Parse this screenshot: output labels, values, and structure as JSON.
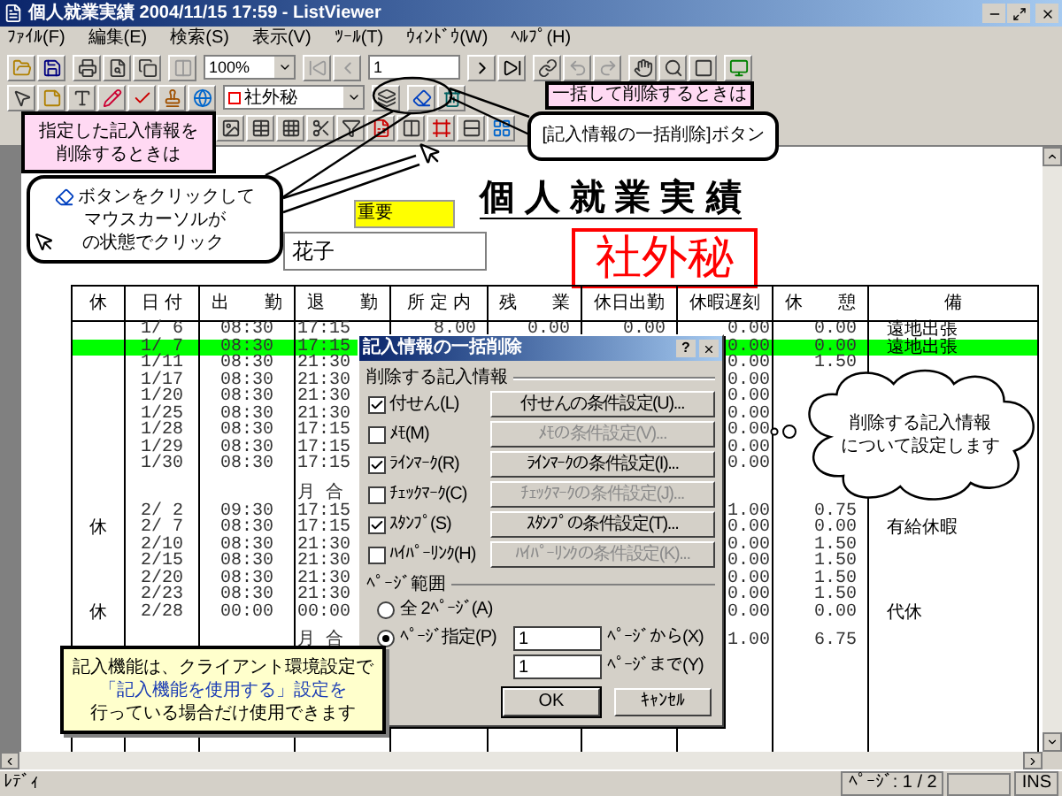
{
  "window": {
    "title": "個人就業実績 2004/11/15 17:59 - ListViewer"
  },
  "menu": [
    "ﾌｧｲﾙ(F)",
    "編集(E)",
    "検索(S)",
    "表示(V)",
    "ﾂｰﾙ(T)",
    "ｳｨﾝﾄﾞｳ(W)",
    "ﾍﾙﾌﾟ(H)"
  ],
  "toolbar": {
    "zoom": "100%",
    "page": "1",
    "stamp_select": "社外秘"
  },
  "document": {
    "badge": "重要",
    "title": "個 人 就 業 実 績",
    "name": "花子",
    "stamp": "社外秘",
    "table": {
      "columns": [
        "休",
        "日 付",
        "出　　勤",
        "退　　勤",
        "所 定 内",
        "残　　業",
        "休日出勤",
        "休暇遅刻",
        "休　　憩",
        "備"
      ],
      "rows": [
        {
          "kind": "day",
          "highlighted": false,
          "date": "1/ 6",
          "in": "08:30",
          "out": "17:15",
          "regular": "8.00",
          "overtime": "0.00",
          "holiday": "0.00",
          "absence": "0.00",
          "break": "0.00",
          "note": "遠地出張"
        },
        {
          "kind": "day",
          "highlighted": true,
          "date": "1/ 7",
          "in": "08:30",
          "out": "17:15",
          "absence": "0.00",
          "break": "0.00",
          "note": "遠地出張"
        },
        {
          "kind": "day",
          "highlighted": false,
          "date": "1/11",
          "in": "08:30",
          "out": "21:30",
          "absence": "0.00",
          "break": "1.50"
        },
        {
          "kind": "day",
          "highlighted": false,
          "date": "1/17",
          "in": "08:30",
          "out": "21:30",
          "absence": "0.00"
        },
        {
          "kind": "day",
          "highlighted": false,
          "date": "1/20",
          "in": "08:30",
          "out": "21:30",
          "absence": "0.00"
        },
        {
          "kind": "day",
          "highlighted": false,
          "date": "1/25",
          "in": "08:30",
          "out": "21:30",
          "absence": "0.00"
        },
        {
          "kind": "day",
          "highlighted": false,
          "date": "1/28",
          "in": "08:30",
          "out": "17:15",
          "absence": "0.00"
        },
        {
          "kind": "day",
          "highlighted": false,
          "date": "1/29",
          "in": "08:30",
          "out": "17:15",
          "absence": "0.00"
        },
        {
          "kind": "day",
          "highlighted": false,
          "date": "1/30",
          "in": "08:30",
          "out": "17:15",
          "absence": "0.00"
        },
        {
          "kind": "total",
          "highlighted": false,
          "label": "月 合"
        },
        {
          "kind": "day",
          "highlighted": false,
          "date": "2/ 2",
          "in": "09:30",
          "out": "17:15",
          "absence": "1.00",
          "break": "0.75"
        },
        {
          "kind": "day",
          "highlighted": false,
          "leave": "休",
          "date": "2/ 7",
          "in": "08:30",
          "out": "17:15",
          "absence": "0.00",
          "break": "0.00",
          "note": "有給休暇"
        },
        {
          "kind": "day",
          "highlighted": false,
          "date": "2/10",
          "in": "08:30",
          "out": "21:30",
          "absence": "0.00",
          "break": "1.50"
        },
        {
          "kind": "day",
          "highlighted": false,
          "date": "2/15",
          "in": "08:30",
          "out": "21:30",
          "absence": "0.00",
          "break": "1.50"
        },
        {
          "kind": "day",
          "highlighted": false,
          "date": "2/20",
          "in": "08:30",
          "out": "21:30",
          "absence": "0.00",
          "break": "1.50"
        },
        {
          "kind": "day",
          "highlighted": false,
          "date": "2/23",
          "in": "08:30",
          "out": "21:30",
          "absence": "0.00",
          "break": "1.50"
        },
        {
          "kind": "day",
          "highlighted": false,
          "leave": "休",
          "date": "2/28",
          "in": "00:00",
          "out": "00:00",
          "absence": "0.00",
          "break": "0.00",
          "note": "代休"
        },
        {
          "kind": "total",
          "highlighted": false,
          "label": "月 合",
          "absence": "1.00",
          "break": "6.75"
        }
      ]
    }
  },
  "dialog": {
    "title": "記入情報の一括削除",
    "help": "?",
    "delete_group": "削除する記入情報",
    "items": [
      {
        "label": "付せん(L)",
        "checked": true,
        "button": "付せんの条件設定(U)...",
        "disabled": false
      },
      {
        "label": "ﾒﾓ(M)",
        "checked": false,
        "button": "ﾒﾓの条件設定(V)...",
        "disabled": true
      },
      {
        "label": "ﾗｲﾝﾏｰｸ(R)",
        "checked": true,
        "button": "ﾗｲﾝﾏｰｸの条件設定(I)...",
        "disabled": false
      },
      {
        "label": "ﾁｪｯｸﾏｰｸ(C)",
        "checked": false,
        "button": "ﾁｪｯｸﾏｰｸの条件設定(J)...",
        "disabled": true
      },
      {
        "label": "ｽﾀﾝﾌﾟ(S)",
        "checked": true,
        "button": "ｽﾀﾝﾌﾟの条件設定(T)...",
        "disabled": false
      },
      {
        "label": "ﾊｲﾊﾟｰﾘﾝｸ(H)",
        "checked": false,
        "button": "ﾊｲﾊﾟｰﾘﾝｸの条件設定(K)...",
        "disabled": true
      }
    ],
    "range_group": "ﾍﾟｰｼﾞ範囲",
    "range_options": [
      {
        "label": "全 2ﾍﾟｰｼﾞ(A)",
        "selected": false
      },
      {
        "label": "ﾍﾟｰｼﾞ指定(P)",
        "selected": true
      }
    ],
    "from": {
      "value": "1",
      "label": "ﾍﾟｰｼﾞから(X)"
    },
    "to": {
      "value": "1",
      "label": "ﾍﾟｰｼﾞまで(Y)"
    },
    "buttons": [
      "OK",
      "ｷｬﾝｾﾙ"
    ]
  },
  "callouts": {
    "select_heading": [
      "指定した記入情報を",
      "削除するときは"
    ],
    "select_steps": [
      "ボタンをクリックして",
      "マウスカーソルが",
      "の状態でクリック"
    ],
    "bulk_heading": "一括して削除するときは",
    "bulk_button": "[記入情報の一括削除]ボタン",
    "dialog_note": [
      "削除する記入情報",
      "について設定します"
    ],
    "requirement": [
      {
        "text": "記入機能は、クライアント環境設定で",
        "color": "#000000"
      },
      {
        "text": "「記入機能を使用する」設定を",
        "color": "#1a3cb4"
      },
      {
        "text": "行っている場合だけ使用できます",
        "color": "#000000"
      }
    ]
  },
  "status_bar": {
    "state": "ﾚﾃﾞｨ",
    "page": "ﾍﾟｰｼﾞ: 1 / 2",
    "mode": "INS"
  }
}
